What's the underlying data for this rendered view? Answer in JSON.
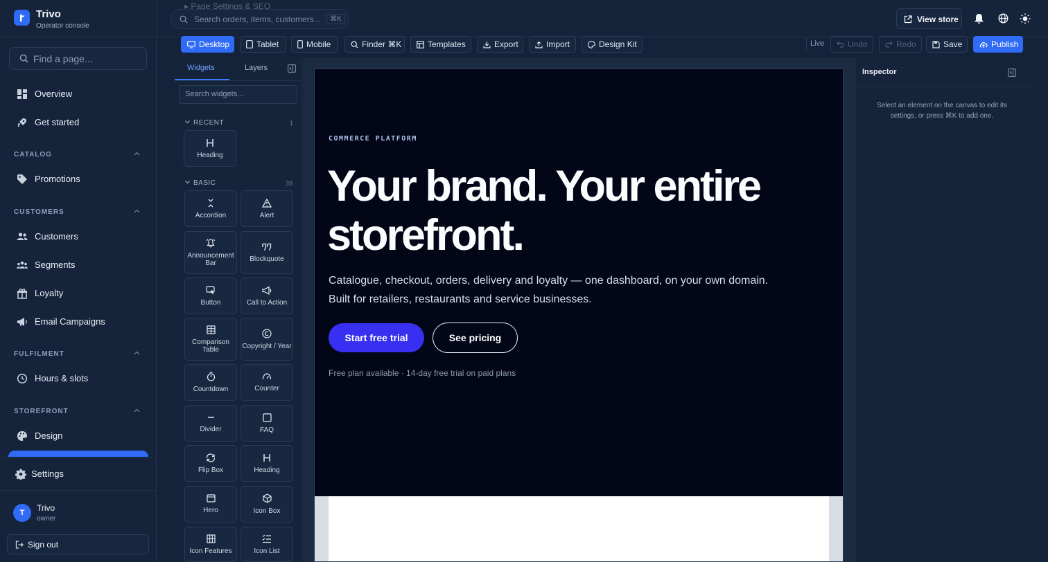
{
  "app": {
    "name": "Trivo",
    "subtitle": "Operator console"
  },
  "sidebar": {
    "find_placeholder": "Find a page...",
    "top_items": [
      {
        "label": "Overview",
        "icon": "grid-icon"
      },
      {
        "label": "Get started",
        "icon": "rocket-icon"
      }
    ],
    "sections": [
      {
        "title": "CATALOG",
        "items": [
          {
            "label": "Promotions",
            "icon": "tag-icon"
          }
        ]
      },
      {
        "title": "CUSTOMERS",
        "items": [
          {
            "label": "Customers",
            "icon": "users-icon"
          },
          {
            "label": "Segments",
            "icon": "group-icon"
          },
          {
            "label": "Loyalty",
            "icon": "gift-icon"
          },
          {
            "label": "Email Campaigns",
            "icon": "megaphone-icon"
          }
        ]
      },
      {
        "title": "FULFILMENT",
        "items": [
          {
            "label": "Hours & slots",
            "icon": "clock-icon"
          }
        ]
      },
      {
        "title": "STOREFRONT",
        "items": [
          {
            "label": "Design",
            "icon": "palette-icon"
          }
        ]
      }
    ],
    "settings_label": "Settings",
    "user": {
      "initial": "T",
      "name": "Trivo",
      "role": "owner"
    },
    "sign_out": "Sign out"
  },
  "topbar": {
    "breadcrumb": "▸ Page Settings & SEO",
    "search_placeholder": "Search orders, items, customers...",
    "search_shortcut": "⌘K",
    "view_store": "View store"
  },
  "toolbar": {
    "buttons": [
      "Desktop",
      "Tablet",
      "Mobile",
      "Finder ⌘K",
      "Templates",
      "Export",
      "Import",
      "Design Kit"
    ],
    "active_device": "Desktop",
    "live": "Live",
    "undo": "Undo",
    "redo": "Redo",
    "save": "Save",
    "publish": "Publish"
  },
  "widgets_panel": {
    "tabs": [
      "Widgets",
      "Layers"
    ],
    "active_tab": "Widgets",
    "search_placeholder": "Search widgets...",
    "groups": [
      {
        "title": "RECENT",
        "count": "1",
        "items": [
          "Heading"
        ]
      },
      {
        "title": "BASIC",
        "count": "39",
        "items": [
          "Accordion",
          "Alert",
          "Announcement Bar",
          "Blockquote",
          "Button",
          "Call to Action",
          "Comparison Table",
          "Copyright / Year",
          "Countdown",
          "Counter",
          "Divider",
          "FAQ",
          "Flip Box",
          "Heading",
          "Hero",
          "Icon Box",
          "Icon Features",
          "Icon List"
        ]
      }
    ]
  },
  "canvas": {
    "eyebrow": "COMMERCE PLATFORM",
    "headline": "Your brand. Your entire storefront.",
    "description": "Catalogue, checkout, orders, delivery and loyalty — one dashboard, on your own domain. Built for retailers, restaurants and service businesses.",
    "primary_cta": "Start free trial",
    "secondary_cta": "See pricing",
    "note": "Free plan available · 14-day free trial on paid plans"
  },
  "inspector": {
    "title": "Inspector",
    "empty_text": "Select an element on the canvas to edit its settings, or press ⌘K to add one."
  },
  "colors": {
    "accent": "#2f6bf5",
    "cta": "#3730f0",
    "panel": "#15243b",
    "canvas_bg": "#020617"
  }
}
